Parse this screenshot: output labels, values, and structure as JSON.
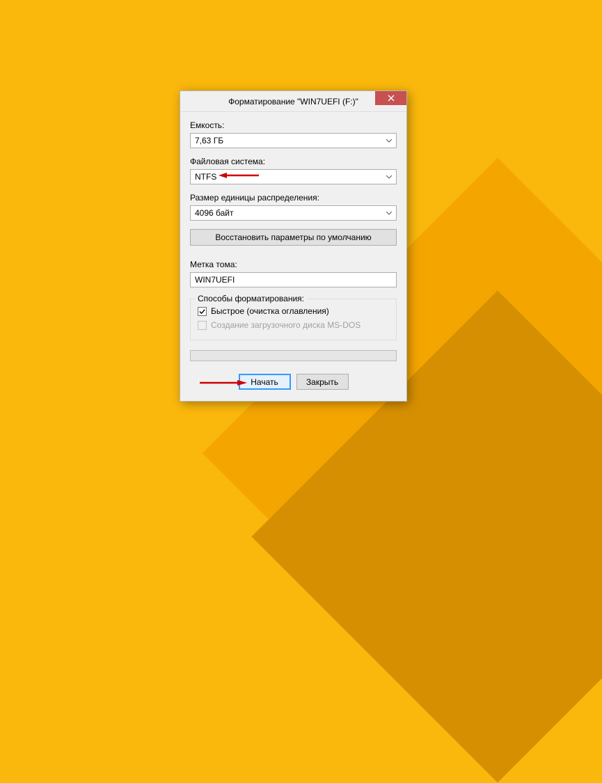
{
  "dialog": {
    "title": "Форматирование \"WIN7UEFI (F:)\""
  },
  "fields": {
    "capacity": {
      "label": "Емкость:",
      "value": "7,63 ГБ"
    },
    "filesystem": {
      "label": "Файловая система:",
      "value": "NTFS"
    },
    "allocation": {
      "label": "Размер единицы распределения:",
      "value": "4096 байт"
    },
    "restore_defaults": "Восстановить параметры по умолчанию",
    "volume_label": {
      "label": "Метка тома:",
      "value": "WIN7UEFI"
    }
  },
  "format_options": {
    "title": "Способы форматирования:",
    "quick": {
      "label": "Быстрое (очистка оглавления)",
      "checked": true
    },
    "msdos": {
      "label": "Создание загрузочного диска MS-DOS",
      "checked": false,
      "disabled": true
    }
  },
  "buttons": {
    "start": "Начать",
    "close": "Закрыть"
  }
}
